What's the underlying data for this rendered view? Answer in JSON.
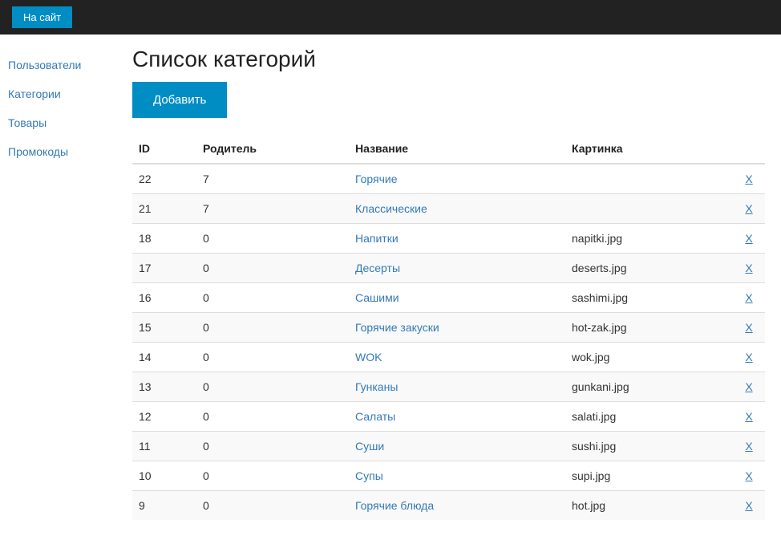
{
  "topbar": {
    "site_link": "На сайт"
  },
  "sidebar": {
    "items": [
      {
        "label": "Пользователи"
      },
      {
        "label": "Категории"
      },
      {
        "label": "Товары"
      },
      {
        "label": "Промокоды"
      }
    ]
  },
  "main": {
    "title": "Список категорий",
    "add_button": "Добавить"
  },
  "table": {
    "headers": {
      "id": "ID",
      "parent": "Родитель",
      "name": "Название",
      "image": "Картинка"
    },
    "rows": [
      {
        "id": "22",
        "parent": "7",
        "name": "Горячие",
        "image": "",
        "delete": "X"
      },
      {
        "id": "21",
        "parent": "7",
        "name": "Классические",
        "image": "",
        "delete": "X"
      },
      {
        "id": "18",
        "parent": "0",
        "name": "Напитки",
        "image": "napitki.jpg",
        "delete": "X"
      },
      {
        "id": "17",
        "parent": "0",
        "name": "Десерты",
        "image": "deserts.jpg",
        "delete": "X"
      },
      {
        "id": "16",
        "parent": "0",
        "name": "Сашими",
        "image": "sashimi.jpg",
        "delete": "X"
      },
      {
        "id": "15",
        "parent": "0",
        "name": "Горячие закуски",
        "image": "hot-zak.jpg",
        "delete": "X"
      },
      {
        "id": "14",
        "parent": "0",
        "name": "WOK",
        "image": "wok.jpg",
        "delete": "X"
      },
      {
        "id": "13",
        "parent": "0",
        "name": "Гунканы",
        "image": "gunkani.jpg",
        "delete": "X"
      },
      {
        "id": "12",
        "parent": "0",
        "name": "Салаты",
        "image": "salati.jpg",
        "delete": "X"
      },
      {
        "id": "11",
        "parent": "0",
        "name": "Суши",
        "image": "sushi.jpg",
        "delete": "X"
      },
      {
        "id": "10",
        "parent": "0",
        "name": "Супы",
        "image": "supi.jpg",
        "delete": "X"
      },
      {
        "id": "9",
        "parent": "0",
        "name": "Горячие блюда",
        "image": "hot.jpg",
        "delete": "X"
      }
    ]
  }
}
